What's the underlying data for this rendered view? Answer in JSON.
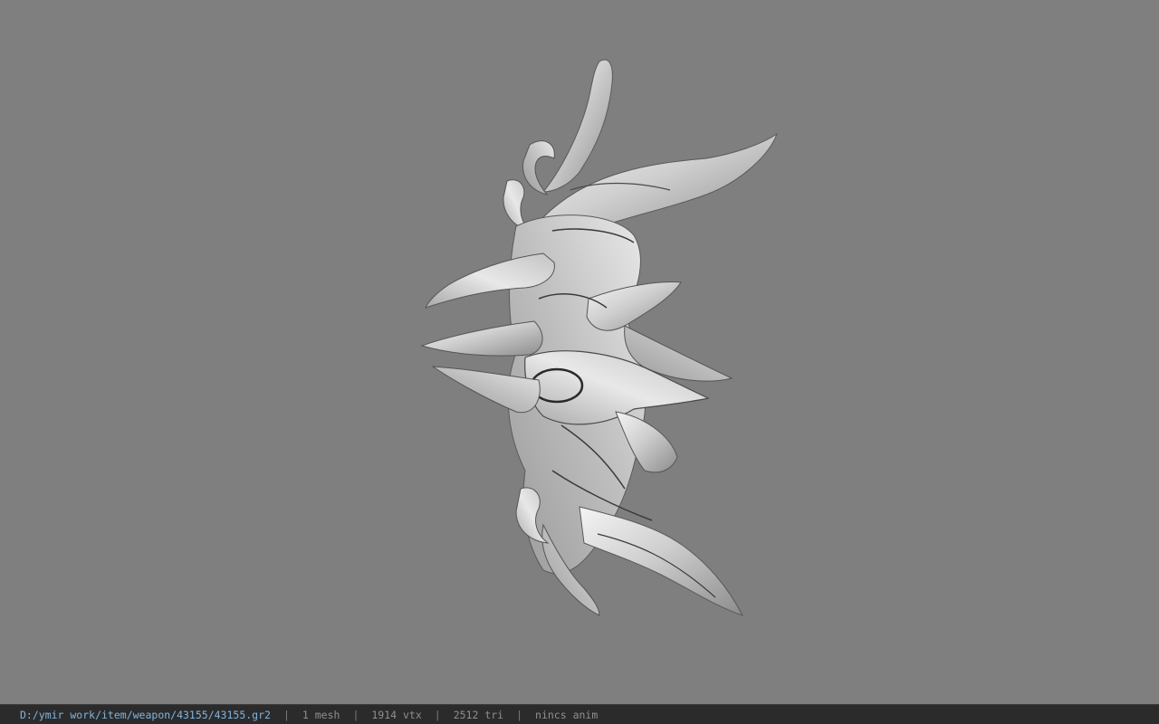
{
  "viewer": {
    "background_color": "#7f7f7f",
    "model_icon": "spiked-weapon-model"
  },
  "status": {
    "file_path": "D:/ymir work/item/weapon/43155/43155.gr2",
    "separator": "|",
    "meshes": "1 mesh",
    "vertices": "1914 vtx",
    "triangles": "2512 tri",
    "animation": "nincs anim",
    "colors": {
      "bar_bg": "#2b2b2b",
      "path": "#7fb6e0",
      "text": "#8f8f8f"
    }
  }
}
